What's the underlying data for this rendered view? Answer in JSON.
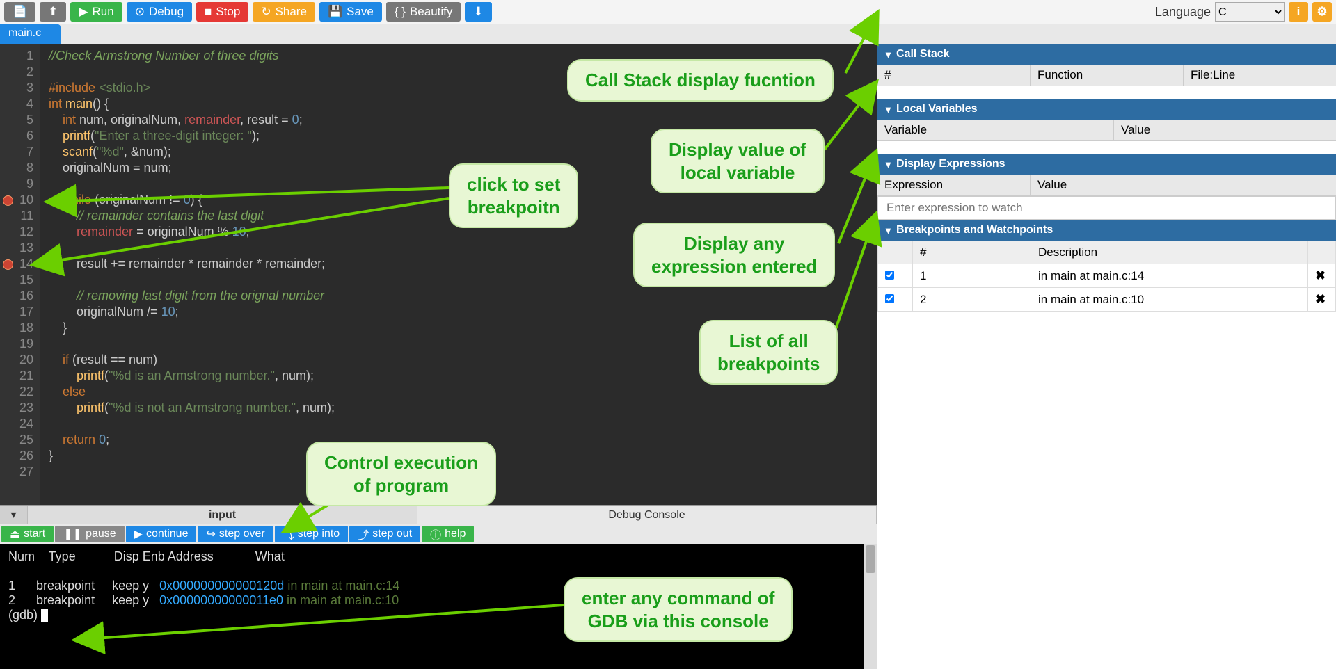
{
  "toolbar": {
    "new_file": "📄",
    "upload": "⬆",
    "run": "Run",
    "debug": "Debug",
    "stop": "Stop",
    "share": "Share",
    "save": "Save",
    "beautify": "Beautify",
    "download": "⬇",
    "language_label": "Language",
    "language_value": "C",
    "info": "i",
    "settings": "⚙"
  },
  "tabs": {
    "file": "main.c"
  },
  "editor": {
    "lines": [
      {
        "n": 1,
        "bp": false
      },
      {
        "n": 2,
        "bp": false
      },
      {
        "n": 3,
        "bp": false
      },
      {
        "n": 4,
        "bp": false
      },
      {
        "n": 5,
        "bp": false
      },
      {
        "n": 6,
        "bp": false
      },
      {
        "n": 7,
        "bp": false
      },
      {
        "n": 8,
        "bp": false
      },
      {
        "n": 9,
        "bp": false
      },
      {
        "n": 10,
        "bp": true
      },
      {
        "n": 11,
        "bp": false
      },
      {
        "n": 12,
        "bp": false
      },
      {
        "n": 13,
        "bp": false
      },
      {
        "n": 14,
        "bp": true
      },
      {
        "n": 15,
        "bp": false
      },
      {
        "n": 16,
        "bp": false
      },
      {
        "n": 17,
        "bp": false
      },
      {
        "n": 18,
        "bp": false
      },
      {
        "n": 19,
        "bp": false
      },
      {
        "n": 20,
        "bp": false
      },
      {
        "n": 21,
        "bp": false
      },
      {
        "n": 22,
        "bp": false
      },
      {
        "n": 23,
        "bp": false
      },
      {
        "n": 24,
        "bp": false
      },
      {
        "n": 25,
        "bp": false
      },
      {
        "n": 26,
        "bp": false
      },
      {
        "n": 27,
        "bp": false
      }
    ],
    "code_plain": "//Check Armstrong Number of three digits\n\n#include <stdio.h>\nint main() {\n    int num, originalNum, remainder, result = 0;\n    printf(\"Enter a three-digit integer: \");\n    scanf(\"%d\", &num);\n    originalNum = num;\n\n    while (originalNum != 0) {\n        // remainder contains the last digit\n        remainder = originalNum % 10;\n\n        result += remainder * remainder * remainder;\n\n        // removing last digit from the orignal number\n        originalNum /= 10;\n    }\n\n    if (result == num)\n        printf(\"%d is an Armstrong number.\", num);\n    else\n        printf(\"%d is not an Armstrong number.\", num);\n\n    return 0;\n}\n"
  },
  "console_tabs": {
    "dropdown": "▾",
    "input": "input",
    "debug": "Debug Console"
  },
  "debug_bar": {
    "start": "start",
    "pause": "pause",
    "continue": "continue",
    "step_over": "step over",
    "step_into": "step into",
    "step_out": "step out",
    "help": "help"
  },
  "console": {
    "header": "Num    Type           Disp Enb Address            What",
    "rows": [
      {
        "num": "1",
        "type": "breakpoint",
        "disp": "keep",
        "enb": "y",
        "addr": "0x000000000000120d",
        "what": "in main at main.c:14"
      },
      {
        "num": "2",
        "type": "breakpoint",
        "disp": "keep",
        "enb": "y",
        "addr": "0x00000000000011e0",
        "what": "in main at main.c:10"
      }
    ],
    "prompt": "(gdb) "
  },
  "panels": {
    "callstack": {
      "title": "Call Stack",
      "cols": [
        "#",
        "Function",
        "File:Line"
      ]
    },
    "localvars": {
      "title": "Local Variables",
      "cols": [
        "Variable",
        "Value"
      ]
    },
    "displayexpr": {
      "title": "Display Expressions",
      "cols": [
        "Expression",
        "Value"
      ],
      "placeholder": "Enter expression to watch"
    },
    "breakpoints": {
      "title": "Breakpoints and Watchpoints",
      "cols": [
        "",
        "#",
        "Description",
        ""
      ],
      "rows": [
        {
          "checked": true,
          "num": "1",
          "desc": "in main at main.c:14"
        },
        {
          "checked": true,
          "num": "2",
          "desc": "in main at main.c:10"
        }
      ]
    }
  },
  "annotations": {
    "a1": "Call Stack display fucntion",
    "a2": "Display value of\nlocal variable",
    "a3": "Display any\nexpression entered",
    "a4": "List of all\nbreakpoints",
    "a5": "click to set\nbreakpoitn",
    "a6": "Control execution\nof program",
    "a7": "enter any command of\nGDB via this console"
  }
}
